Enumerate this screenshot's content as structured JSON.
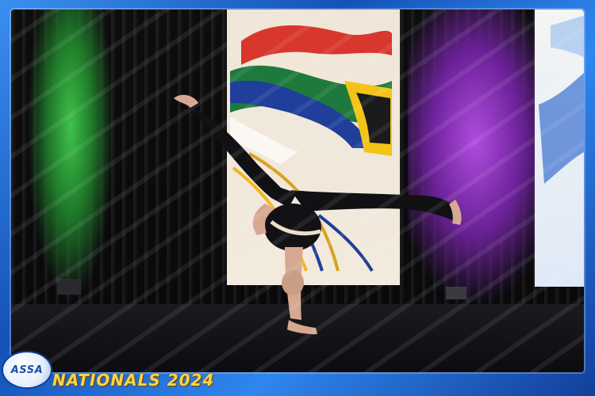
{
  "event": {
    "logo_text": "ASSA",
    "title": "NATIONALS 2024"
  },
  "image": {
    "subject": "dancer in black leotard performing a one-hand handstand on stage",
    "frame_color": "#1c6fd6",
    "title_color": "#f7d34a"
  }
}
